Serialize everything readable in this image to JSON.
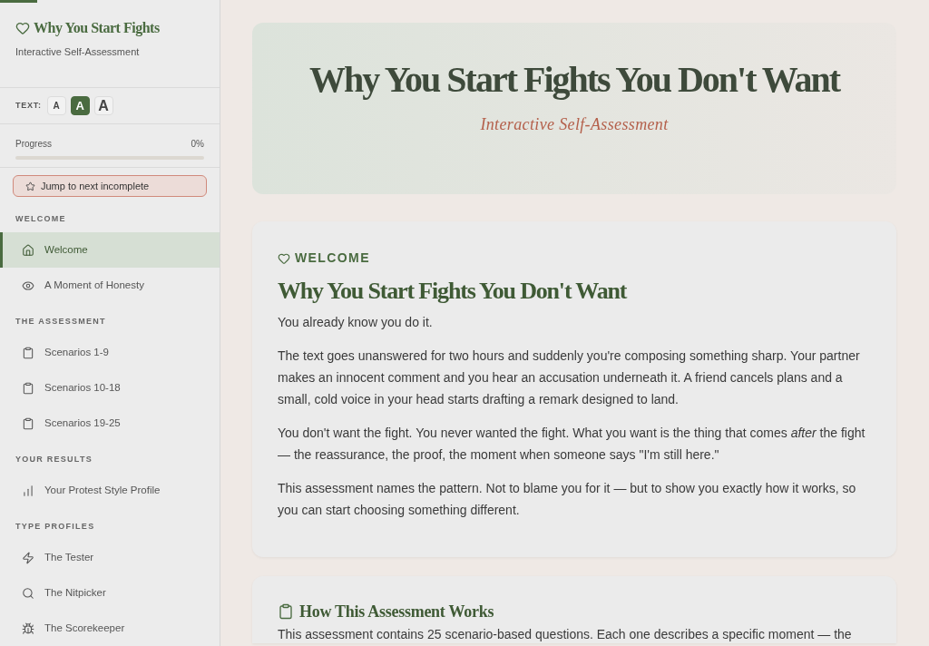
{
  "reading_progress": {
    "level": 0.04
  },
  "sidebar": {
    "title": "Why You Start Fights",
    "subtitle": "Interactive Self-Assessment",
    "text_size": {
      "label": "TEXT:",
      "options": [
        {
          "label": "A",
          "kind": "small",
          "selected": false
        },
        {
          "label": "A",
          "kind": "medium",
          "selected": true
        },
        {
          "label": "A",
          "kind": "large",
          "selected": false
        }
      ]
    },
    "progress": {
      "label": "Progress",
      "value": "0%",
      "level": 0
    },
    "jump_button": "Jump to next incomplete",
    "sections": [
      {
        "heading": "WELCOME",
        "items": [
          {
            "label": "Welcome",
            "selected": true
          },
          {
            "label": "A Moment of Honesty",
            "selected": false
          }
        ]
      },
      {
        "heading": "THE ASSESSMENT",
        "items": [
          {
            "label": "Scenarios 1-9",
            "selected": false
          },
          {
            "label": "Scenarios 10-18",
            "selected": false
          },
          {
            "label": "Scenarios 19-25",
            "selected": false
          }
        ]
      },
      {
        "heading": "YOUR RESULTS",
        "items": [
          {
            "label": "Your Protest Style Profile",
            "selected": false
          }
        ]
      },
      {
        "heading": "TYPE PROFILES",
        "items": [
          {
            "label": "The Tester",
            "selected": false
          },
          {
            "label": "The Nitpicker",
            "selected": false
          },
          {
            "label": "The Scorekeeper",
            "selected": false
          }
        ]
      }
    ]
  },
  "hero": {
    "title": "Why You Start Fights You Don't Want",
    "subtitle": "Interactive Self-Assessment"
  },
  "cards": [
    {
      "kind": "intro",
      "eyebrow": "WELCOME",
      "title": "Why You Start Fights You Don't Want",
      "paragraphs": [
        "You already know you do it.",
        "The text goes unanswered for two hours and suddenly you're composing something sharp. Your partner makes an innocent comment and you hear an accusation underneath it. A friend cancels plans and a small, cold voice in your head starts drafting a remark designed to land.",
        "You don't want the fight. You never wanted the fight. What you want is the thing that comes *after* the fight — the reassurance, the proof, the moment when someone says \"I'm still here.\"",
        "This assessment names the pattern. Not to blame you for it — but to show you exactly how it works, so you can start choosing something different."
      ]
    },
    {
      "kind": "section",
      "title": "How This Assessment Works",
      "paragraphs": [
        "This assessment contains 25 scenario-based questions. Each one describes a specific moment — the"
      ]
    }
  ]
}
